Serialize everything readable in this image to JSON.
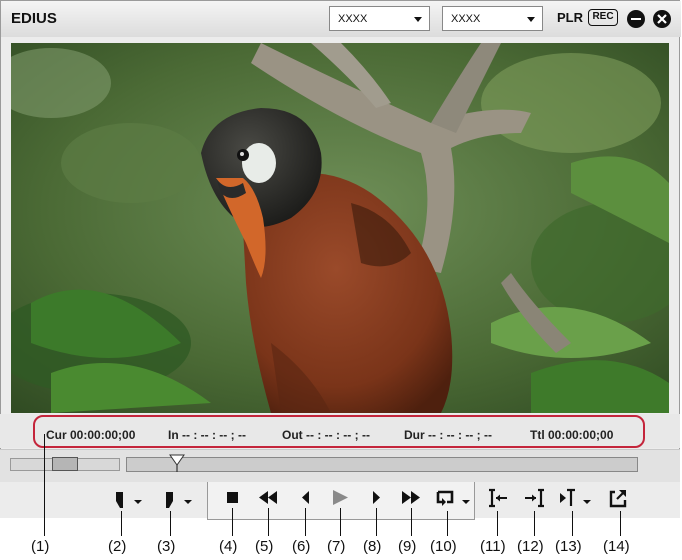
{
  "app": {
    "title": "EDIUS"
  },
  "header": {
    "dropdown1": "XXXX",
    "dropdown2": "XXXX",
    "plr": "PLR",
    "rec": "REC"
  },
  "status": {
    "cur": "Cur 00:00:00;00",
    "in": "In -- : -- : -- ; --",
    "out": "Out -- : -- : -- ; --",
    "dur": "Dur -- : -- : -- ; --",
    "ttl": "Ttl 00:00:00;00"
  },
  "callouts": [
    "(1)",
    "(2)",
    "(3)",
    "(4)",
    "(5)",
    "(6)",
    "(7)",
    "(8)",
    "(9)",
    "(10)",
    "(11)",
    "(12)",
    "(13)",
    "(14)"
  ],
  "controls": [
    "set-in-icon",
    "set-out-icon",
    "stop-icon",
    "rewind-icon",
    "step-back-icon",
    "play-icon",
    "step-forward-icon",
    "fast-forward-icon",
    "loop-icon",
    "go-to-in-icon",
    "go-to-out-icon",
    "play-around-current-icon",
    "export-icon"
  ]
}
